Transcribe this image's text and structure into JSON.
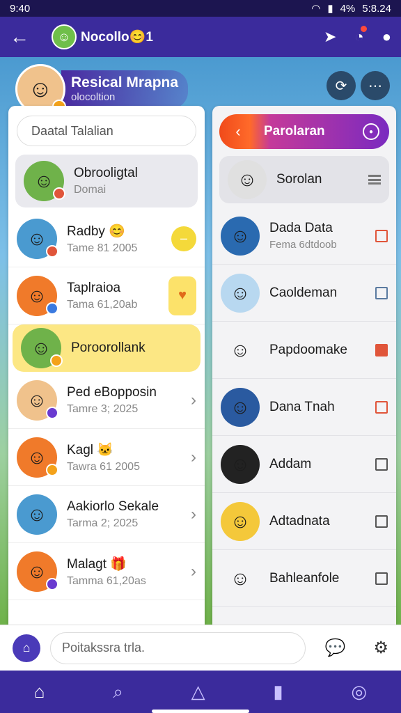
{
  "status_bar": {
    "time": "9:40",
    "battery": "4%",
    "clock_right": "5:8.24"
  },
  "app_bar": {
    "title": "Nocollo😊1"
  },
  "profile": {
    "name": "Resical Mrapna",
    "subtitle": "olocoltion"
  },
  "left_panel": {
    "search_placeholder": "Daatal Talalian",
    "chats": [
      {
        "name": "Obrooligtal",
        "sub": "Domai",
        "style": "gray",
        "avatar_bg": "#6fb24a",
        "badge": "#e0553a",
        "trailing": ""
      },
      {
        "name": "Radby 😊",
        "sub": "Tame 81 2005",
        "style": "",
        "avatar_bg": "#4a9ad0",
        "badge": "#e0553a",
        "trailing": "pill"
      },
      {
        "name": "Taplraioa",
        "sub": "Tama 61,20ab",
        "style": "",
        "avatar_bg": "#f07a2a",
        "badge": "#3a7ae0",
        "trailing": "rect"
      },
      {
        "name": "Poroorollank",
        "sub": "",
        "style": "yellow",
        "avatar_bg": "#6fb24a",
        "badge": "#f4a21a",
        "trailing": ""
      },
      {
        "name": "Ped eBopposin",
        "sub": "Tamre 3; 2025",
        "style": "",
        "avatar_bg": "#f0c28c",
        "badge": "#6a3ad0",
        "trailing": "chevron"
      },
      {
        "name": "Kagl 🐱",
        "sub": "Tawra 61 2005",
        "style": "",
        "avatar_bg": "#f07a2a",
        "badge": "#f4a21a",
        "trailing": "chevron"
      },
      {
        "name": "Aakiorlo Sekale",
        "sub": "Tarma 2; 2025",
        "style": "",
        "avatar_bg": "#4a9ad0",
        "badge": "",
        "trailing": "chevron"
      },
      {
        "name": "Malagt 🎁",
        "sub": "Tamma 61,20as",
        "style": "",
        "avatar_bg": "#f07a2a",
        "badge": "#6a3ad0",
        "trailing": "chevron"
      }
    ]
  },
  "right_panel": {
    "tab_label": "Parolaran",
    "contacts": [
      {
        "name": "Sorolan",
        "sub": "",
        "style": "sel",
        "avatar_bg": "#e0e0e0",
        "check": "menu"
      },
      {
        "name": "Dada Data",
        "sub": "Fema 6dtdoob",
        "style": "",
        "avatar_bg": "#2a6ab0",
        "check": "red"
      },
      {
        "name": "Caoldeman",
        "sub": "",
        "style": "",
        "avatar_bg": "#b8d8f0",
        "check": "blue"
      },
      {
        "name": "Papdoomake",
        "sub": "",
        "style": "",
        "avatar_bg": "#f3f3f5",
        "check": "red-filled"
      },
      {
        "name": "Dana Tnah",
        "sub": "",
        "style": "",
        "avatar_bg": "#2a5aa0",
        "check": "red"
      },
      {
        "name": "Addam",
        "sub": "",
        "style": "",
        "avatar_bg": "#222222",
        "check": "gray"
      },
      {
        "name": "Adtadnata",
        "sub": "",
        "style": "",
        "avatar_bg": "#f4c83a",
        "check": "gray"
      },
      {
        "name": "Bahleanfole",
        "sub": "",
        "style": "",
        "avatar_bg": "#f3f3f5",
        "check": "gray"
      }
    ]
  },
  "composer": {
    "placeholder": "Poitakssra trla."
  },
  "bottom_nav": [
    "home-icon",
    "search-icon",
    "bell-icon",
    "bookmark-icon",
    "settings-icon"
  ]
}
